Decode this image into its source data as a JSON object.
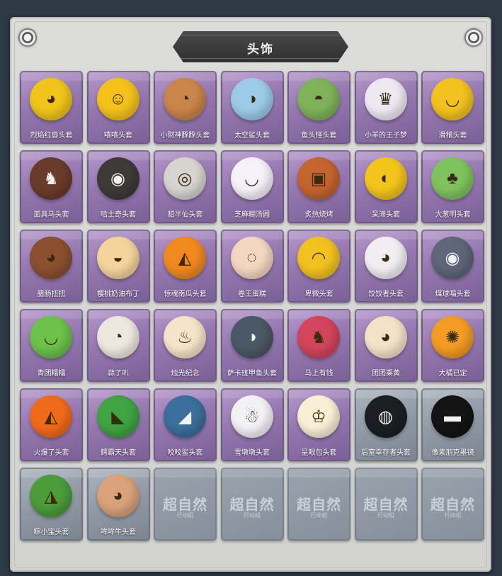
{
  "title": "头饰",
  "items": [
    {
      "label": "烈焰红唇头套",
      "icon": "pikachu-mask-icon",
      "color": "#f0c419",
      "glyph": "◕"
    },
    {
      "label": "嘻嘻头套",
      "icon": "grin-face-icon",
      "color": "#f5c21b",
      "glyph": "☺"
    },
    {
      "label": "小财神豚豚头套",
      "icon": "capybara-icon",
      "color": "#c9854b",
      "glyph": "◔"
    },
    {
      "label": "太空鲨头套",
      "icon": "shark-icon",
      "color": "#9ccbe8",
      "glyph": "◑"
    },
    {
      "label": "鱼头怪头套",
      "icon": "fish-head-icon",
      "color": "#7fb25a",
      "glyph": "◓"
    },
    {
      "label": "小羊的王子梦",
      "icon": "sheep-crown-icon",
      "color": "#eee8f3",
      "glyph": "♛"
    },
    {
      "label": "滑稽头套",
      "icon": "smirk-face-icon",
      "color": "#f3c21e",
      "glyph": "◡"
    },
    {
      "label": "面具马头套",
      "icon": "horse-icon",
      "color": "#6b3b2a",
      "glyph": "♞"
    },
    {
      "label": "哈士奇头套",
      "icon": "husky-icon",
      "color": "#3d3a3a",
      "glyph": "◉"
    },
    {
      "label": "貂半仙头套",
      "icon": "raccoon-icon",
      "color": "#d7d4d0",
      "glyph": "◎"
    },
    {
      "label": "芝麻糊汤圆",
      "icon": "dumpling-icon",
      "color": "#f4f1f8",
      "glyph": "◡"
    },
    {
      "label": "炙热烧烤",
      "icon": "grilled-meat-icon",
      "color": "#c4642e",
      "glyph": "▣"
    },
    {
      "label": "呆滞头套",
      "icon": "dazed-face-icon",
      "color": "#f2c41c",
      "glyph": "◐"
    },
    {
      "label": "大葱明头套",
      "icon": "scallion-icon",
      "color": "#7fc35e",
      "glyph": "♣"
    },
    {
      "label": "腊肠扭扭",
      "icon": "dachshund-icon",
      "color": "#8a5030",
      "glyph": "◕"
    },
    {
      "label": "樱桃奶油布丁",
      "icon": "pudding-icon",
      "color": "#f4d49a",
      "glyph": "◒"
    },
    {
      "label": "惊魂南瓜头套",
      "icon": "pumpkin-icon",
      "color": "#f08a1e",
      "glyph": "◭"
    },
    {
      "label": "卷王蛋糕",
      "icon": "roll-cake-icon",
      "color": "#f3d7c0",
      "glyph": "◌"
    },
    {
      "label": "卑微头套",
      "icon": "humble-face-icon",
      "color": "#f2c11f",
      "glyph": "◠"
    },
    {
      "label": "饺饺者头套",
      "icon": "dumpling-bun-icon",
      "color": "#f0eef1",
      "glyph": "◕"
    },
    {
      "label": "煤球喵头套",
      "icon": "gray-cat-icon",
      "color": "#5e6678",
      "glyph": "◉"
    },
    {
      "label": "青团糯糯",
      "icon": "green-bun-icon",
      "color": "#6cc24a",
      "glyph": "◡"
    },
    {
      "label": "蒜了叭",
      "icon": "garlic-icon",
      "color": "#ece8e0",
      "glyph": "◔"
    },
    {
      "label": "烛光纪念",
      "icon": "candle-icon",
      "color": "#f6e3c8",
      "glyph": "♨"
    },
    {
      "label": "萨卡班甲鱼头套",
      "icon": "fish-icon",
      "color": "#4b5866",
      "glyph": "◑"
    },
    {
      "label": "马上有钱",
      "icon": "red-horse-icon",
      "color": "#d2455c",
      "glyph": "♞"
    },
    {
      "label": "团团乘黄",
      "icon": "cream-beast-icon",
      "color": "#f3e2c8",
      "glyph": "◕"
    },
    {
      "label": "大橘已定",
      "icon": "orange-slice-icon",
      "color": "#f39b22",
      "glyph": "✺"
    },
    {
      "label": "火爆了头套",
      "icon": "fire-face-icon",
      "color": "#f06a1c",
      "glyph": "◭"
    },
    {
      "label": "鳄霸天头套",
      "icon": "crocodile-icon",
      "color": "#3fa441",
      "glyph": "◣"
    },
    {
      "label": "咬咬鲨头套",
      "icon": "biting-shark-icon",
      "color": "#3c6f9c",
      "glyph": "◢"
    },
    {
      "label": "雪墩墩头套",
      "icon": "snowman-icon",
      "color": "#f2f2f5",
      "glyph": "☃"
    },
    {
      "label": "呈眼包头套",
      "icon": "crowned-bulb-icon",
      "color": "#f7f0d6",
      "glyph": "♔"
    },
    {
      "label": "后室幸存者头套",
      "icon": "gas-mask-helmet-icon",
      "color": "#1c1e22",
      "glyph": "◍",
      "gray": true
    },
    {
      "label": "像素朋克墨镜",
      "icon": "pixel-sunglasses-icon",
      "color": "#141414",
      "glyph": "▬",
      "gray": true
    },
    {
      "label": "粽小宝头套",
      "icon": "zongzi-icon",
      "color": "#4c9c3c",
      "glyph": "◮",
      "gray": true
    },
    {
      "label": "哞哞牛头套",
      "icon": "cow-icon",
      "color": "#d9a27a",
      "glyph": "◕",
      "gray": true
    }
  ],
  "empty_slots": [
    {
      "watermark": "超自然",
      "sub": "行动组"
    },
    {
      "watermark": "超自然",
      "sub": "行动组"
    },
    {
      "watermark": "超自然",
      "sub": "行动组"
    },
    {
      "watermark": "超自然",
      "sub": "行动组"
    },
    {
      "watermark": "超自然",
      "sub": "行动组"
    }
  ]
}
